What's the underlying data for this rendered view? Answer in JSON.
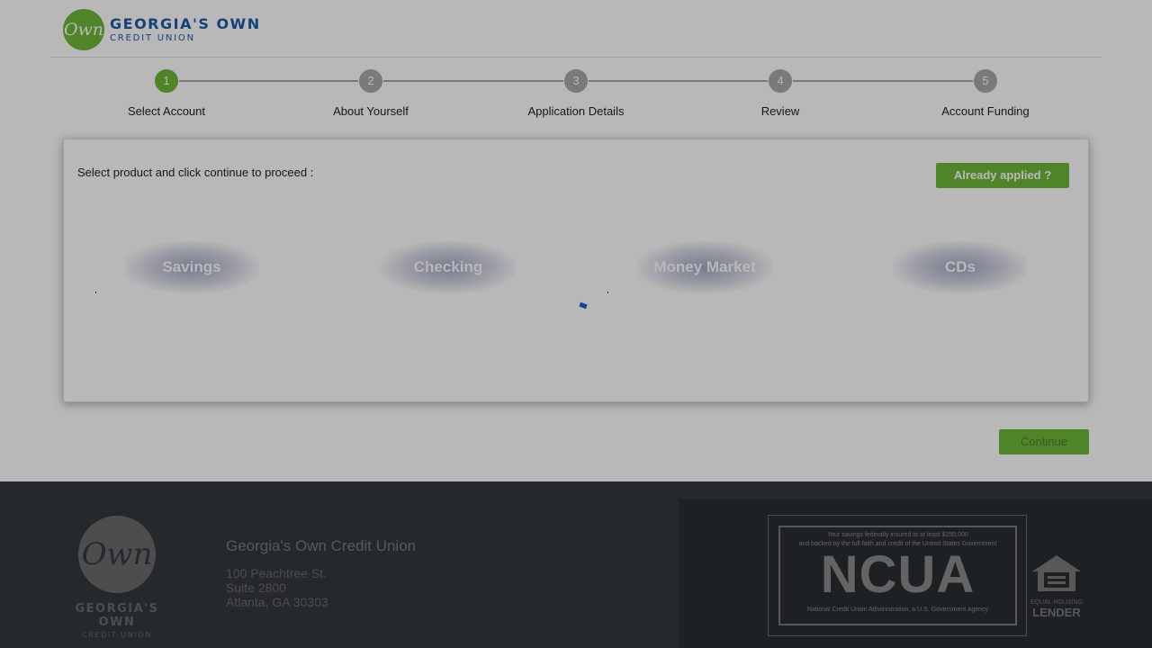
{
  "header": {
    "logo_mark": "Own",
    "logo_main": "GEORGIA'S OWN",
    "logo_sub": "CREDIT UNION"
  },
  "stepper": {
    "steps": [
      {
        "number": "1",
        "label": "Select Account",
        "active": true
      },
      {
        "number": "2",
        "label": "About Yourself",
        "active": false
      },
      {
        "number": "3",
        "label": "Application Details",
        "active": false
      },
      {
        "number": "4",
        "label": "Review",
        "active": false
      },
      {
        "number": "5",
        "label": "Account Funding",
        "active": false
      }
    ]
  },
  "panel": {
    "instruction": "Select product and click continue to proceed :",
    "already_applied_label": "Already applied ?",
    "products": [
      "Savings",
      "Checking",
      "Money Market",
      "CDs"
    ]
  },
  "actions": {
    "continue_label": "Continue"
  },
  "footer": {
    "logo_mark": "Own",
    "logo_main": "GEORGIA'S OWN",
    "logo_sub": "CREDIT UNION",
    "org_name": "Georgia's Own Credit Union",
    "address": [
      "100 Peachtree St.",
      "Suite 2800",
      "Atlanta, GA 30303"
    ],
    "ncua": {
      "top_line1": "Your savings federally insured to at least $250,000",
      "top_line2": "and backed by the full faith and credit of the United States Government",
      "title": "NCUA",
      "bottom": "National Credit Union Administration, a U.S. Government Agency"
    },
    "ehl": {
      "line1": "EQUAL HOUSING",
      "line2": "LENDER"
    }
  },
  "colors": {
    "brand_green": "#6fb83a",
    "brand_blue": "#1e5aa8",
    "footer_bg": "#343a40"
  }
}
